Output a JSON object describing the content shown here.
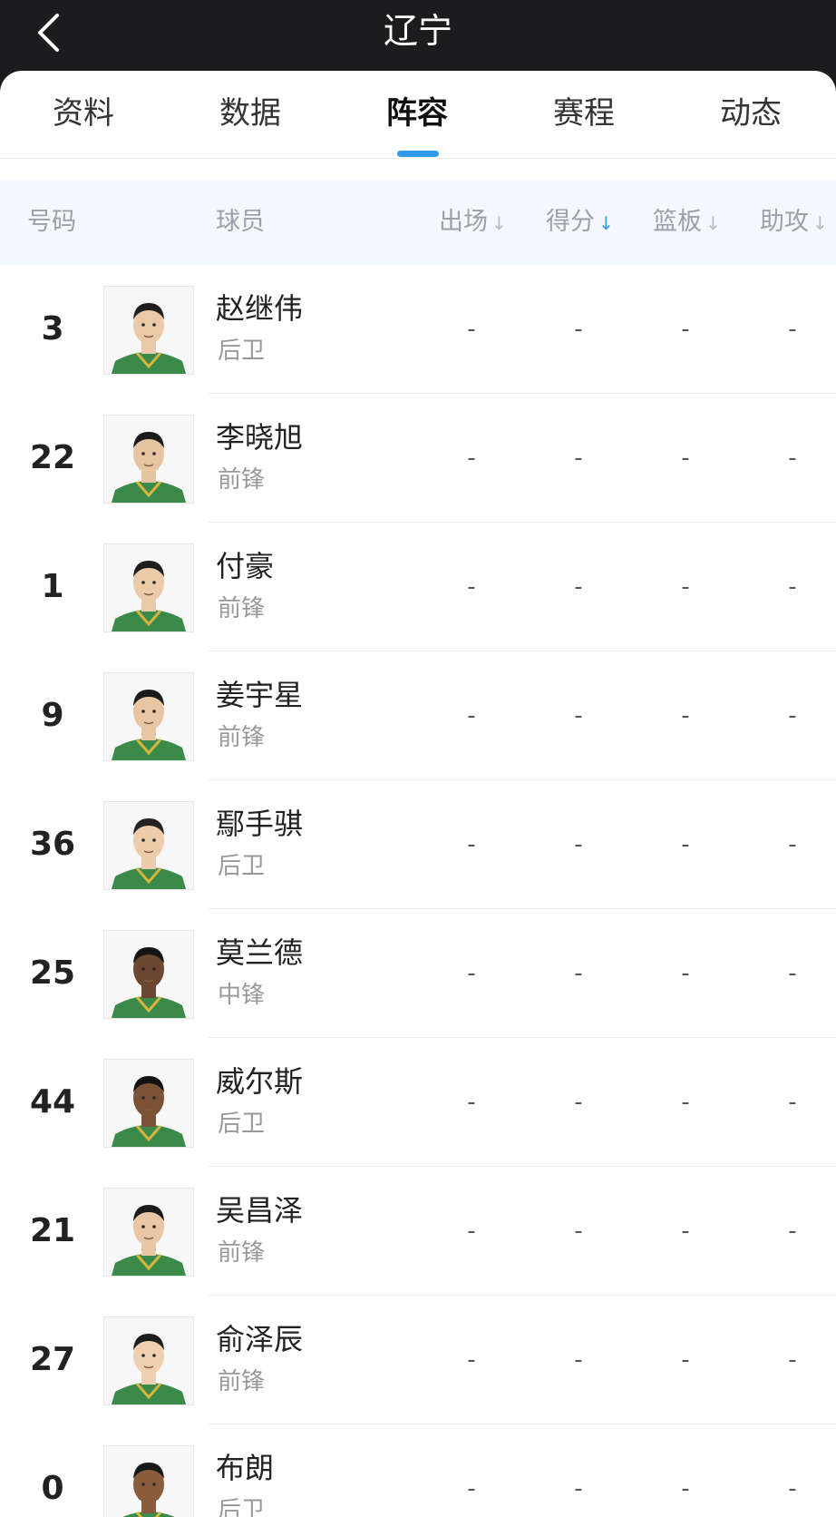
{
  "header": {
    "title": "辽宁",
    "back": "back-arrow-icon"
  },
  "tabs": [
    {
      "label": "资料",
      "active": false
    },
    {
      "label": "数据",
      "active": false
    },
    {
      "label": "阵容",
      "active": true
    },
    {
      "label": "赛程",
      "active": false
    },
    {
      "label": "动态",
      "active": false
    }
  ],
  "columns": {
    "number": "号码",
    "player": "球员",
    "stats": [
      {
        "label": "出场",
        "sort_active": false
      },
      {
        "label": "得分",
        "sort_active": true
      },
      {
        "label": "篮板",
        "sort_active": false
      },
      {
        "label": "助攻",
        "sort_active": false
      }
    ],
    "sort_glyph": "↓"
  },
  "players": [
    {
      "number": "3",
      "name": "赵继伟",
      "position": "后卫",
      "stats": [
        "-",
        "-",
        "-",
        "-"
      ],
      "skin": "#e9c9a8",
      "hair": "#1f1f1f"
    },
    {
      "number": "22",
      "name": "李晓旭",
      "position": "前锋",
      "stats": [
        "-",
        "-",
        "-",
        "-"
      ],
      "skin": "#e6c3a1",
      "hair": "#1a1a1a"
    },
    {
      "number": "1",
      "name": "付豪",
      "position": "前锋",
      "stats": [
        "-",
        "-",
        "-",
        "-"
      ],
      "skin": "#ebcaa9",
      "hair": "#1d1d1d"
    },
    {
      "number": "9",
      "name": "姜宇星",
      "position": "前锋",
      "stats": [
        "-",
        "-",
        "-",
        "-"
      ],
      "skin": "#e8c6a4",
      "hair": "#1c1c1c"
    },
    {
      "number": "36",
      "name": "鄢手骐",
      "position": "后卫",
      "stats": [
        "-",
        "-",
        "-",
        "-"
      ],
      "skin": "#ecccab",
      "hair": "#222222"
    },
    {
      "number": "25",
      "name": "莫兰德",
      "position": "中锋",
      "stats": [
        "-",
        "-",
        "-",
        "-"
      ],
      "skin": "#6b4630",
      "hair": "#141414"
    },
    {
      "number": "44",
      "name": "威尔斯",
      "position": "后卫",
      "stats": [
        "-",
        "-",
        "-",
        "-"
      ],
      "skin": "#7a5236",
      "hair": "#121212"
    },
    {
      "number": "21",
      "name": "吴昌泽",
      "position": "前锋",
      "stats": [
        "-",
        "-",
        "-",
        "-"
      ],
      "skin": "#e9c7a6",
      "hair": "#1b1b1b"
    },
    {
      "number": "27",
      "name": "俞泽辰",
      "position": "前锋",
      "stats": [
        "-",
        "-",
        "-",
        "-"
      ],
      "skin": "#eecfb0",
      "hair": "#1e1e1e"
    },
    {
      "number": "0",
      "name": "布朗",
      "position": "后卫",
      "stats": [
        "-",
        "-",
        "-",
        "-"
      ],
      "skin": "#8a5c3c",
      "hair": "#181818"
    }
  ],
  "colors": {
    "accent": "#2f9be8",
    "jersey": "#3c8a4a",
    "jersey_trim": "#d8b640"
  }
}
